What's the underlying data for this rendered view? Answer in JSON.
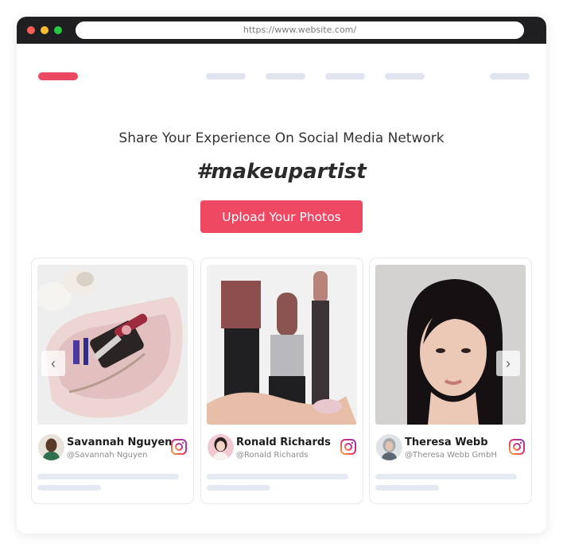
{
  "browser": {
    "url": "https://www.website.com/"
  },
  "hero": {
    "headline": "Share Your Experience On Social Media Network",
    "hashtag": "#makeupartist",
    "upload_label": "Upload Your Photos"
  },
  "carousel": {
    "prev_icon": "‹",
    "next_icon": "›",
    "cards": [
      {
        "name": "Savannah Nguyen",
        "handle": "@Savannah Nguyen",
        "network": "instagram-icon"
      },
      {
        "name": "Ronald Richards",
        "handle": "@Ronald Richards",
        "network": "instagram-icon"
      },
      {
        "name": "Theresa Webb",
        "handle": "@Theresa Webb GmbH",
        "network": "instagram-icon"
      }
    ]
  },
  "colors": {
    "accent": "#ee4862",
    "placeholder": "#dfe4ef"
  }
}
